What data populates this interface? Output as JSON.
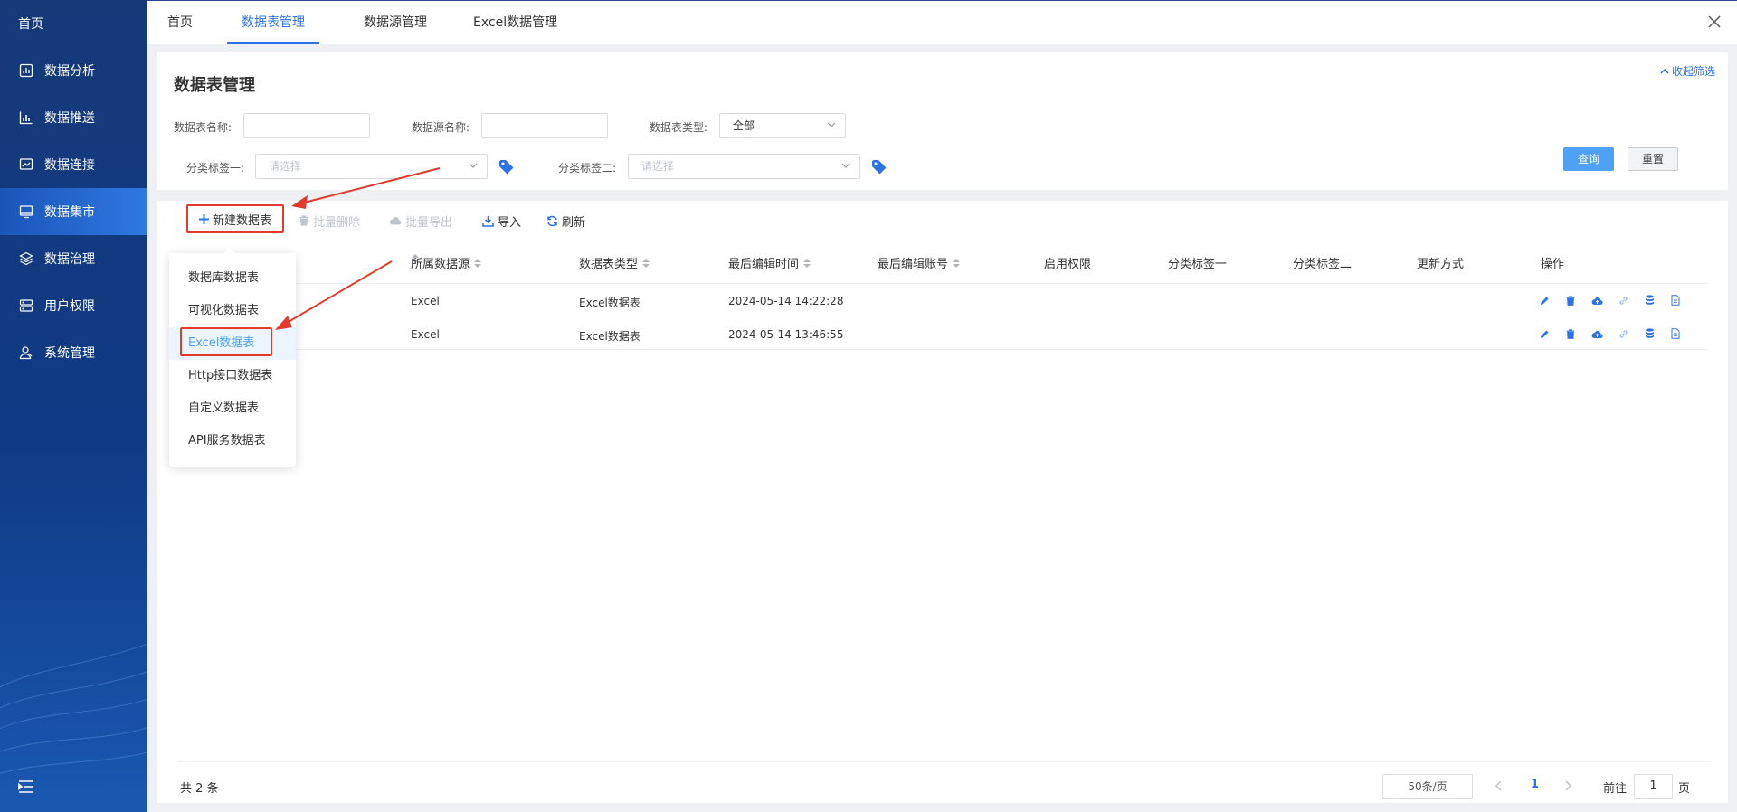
{
  "sidebar": {
    "home": "首页",
    "items": [
      {
        "label": "数据分析",
        "icon": "chart-board-icon"
      },
      {
        "label": "数据推送",
        "icon": "bar-chart-icon"
      },
      {
        "label": "数据连接",
        "icon": "link-chart-icon"
      },
      {
        "label": "数据集市",
        "icon": "monitor-icon"
      },
      {
        "label": "数据治理",
        "icon": "layers-icon"
      },
      {
        "label": "用户权限",
        "icon": "user-group-icon"
      },
      {
        "label": "系统管理",
        "icon": "user-settings-icon"
      }
    ],
    "active_index": 3
  },
  "tabs": [
    {
      "label": "首页"
    },
    {
      "label": "数据表管理"
    },
    {
      "label": "数据源管理"
    },
    {
      "label": "Excel数据管理"
    }
  ],
  "active_tab": 1,
  "filter": {
    "title": "数据表管理",
    "collapse_label": "收起筛选",
    "table_name_label": "数据表名称:",
    "table_name_value": "",
    "source_name_label": "数据源名称:",
    "source_name_value": "",
    "table_type_label": "数据表类型:",
    "table_type_value": "全部",
    "tag1_label": "分类标签一:",
    "tag1_placeholder": "请选择",
    "tag2_label": "分类标签二:",
    "tag2_placeholder": "请选择",
    "query_label": "查询",
    "reset_label": "重置"
  },
  "toolbar": {
    "new_label": "新建数据表",
    "batch_delete_label": "批量删除",
    "batch_export_label": "批量导出",
    "import_label": "导入",
    "refresh_label": "刷新"
  },
  "table": {
    "headers": [
      "所属数据源",
      "数据表类型",
      "最后编辑时间",
      "最后编辑账号",
      "启用权限",
      "分类标签一",
      "分类标签二",
      "更新方式",
      "操作"
    ],
    "rows": [
      {
        "source": "Excel",
        "type": "Excel数据表",
        "time": "2024-05-14 14:22:28"
      },
      {
        "source": "Excel",
        "type": "Excel数据表",
        "time": "2024-05-14 13:46:55"
      }
    ],
    "row_actions": [
      "edit-icon",
      "delete-icon",
      "cloud-upload-icon",
      "link-icon",
      "database-icon",
      "document-icon"
    ]
  },
  "dropdown": {
    "items": [
      "数据库数据表",
      "可视化数据表",
      "Excel数据表",
      "Http接口数据表",
      "自定义数据表",
      "API服务数据表"
    ],
    "highlighted_index": 2
  },
  "pagination": {
    "total": "共 2 条",
    "page_size": "50条/页",
    "current": "1",
    "goto_label": "前往",
    "goto_value": "1",
    "page_suffix": "页"
  },
  "colors": {
    "accent": "#2d73e6",
    "primary_button": "#4ea1f5",
    "annotation_red": "#e23b2e",
    "sidebar_bg": "#0f3a86"
  }
}
